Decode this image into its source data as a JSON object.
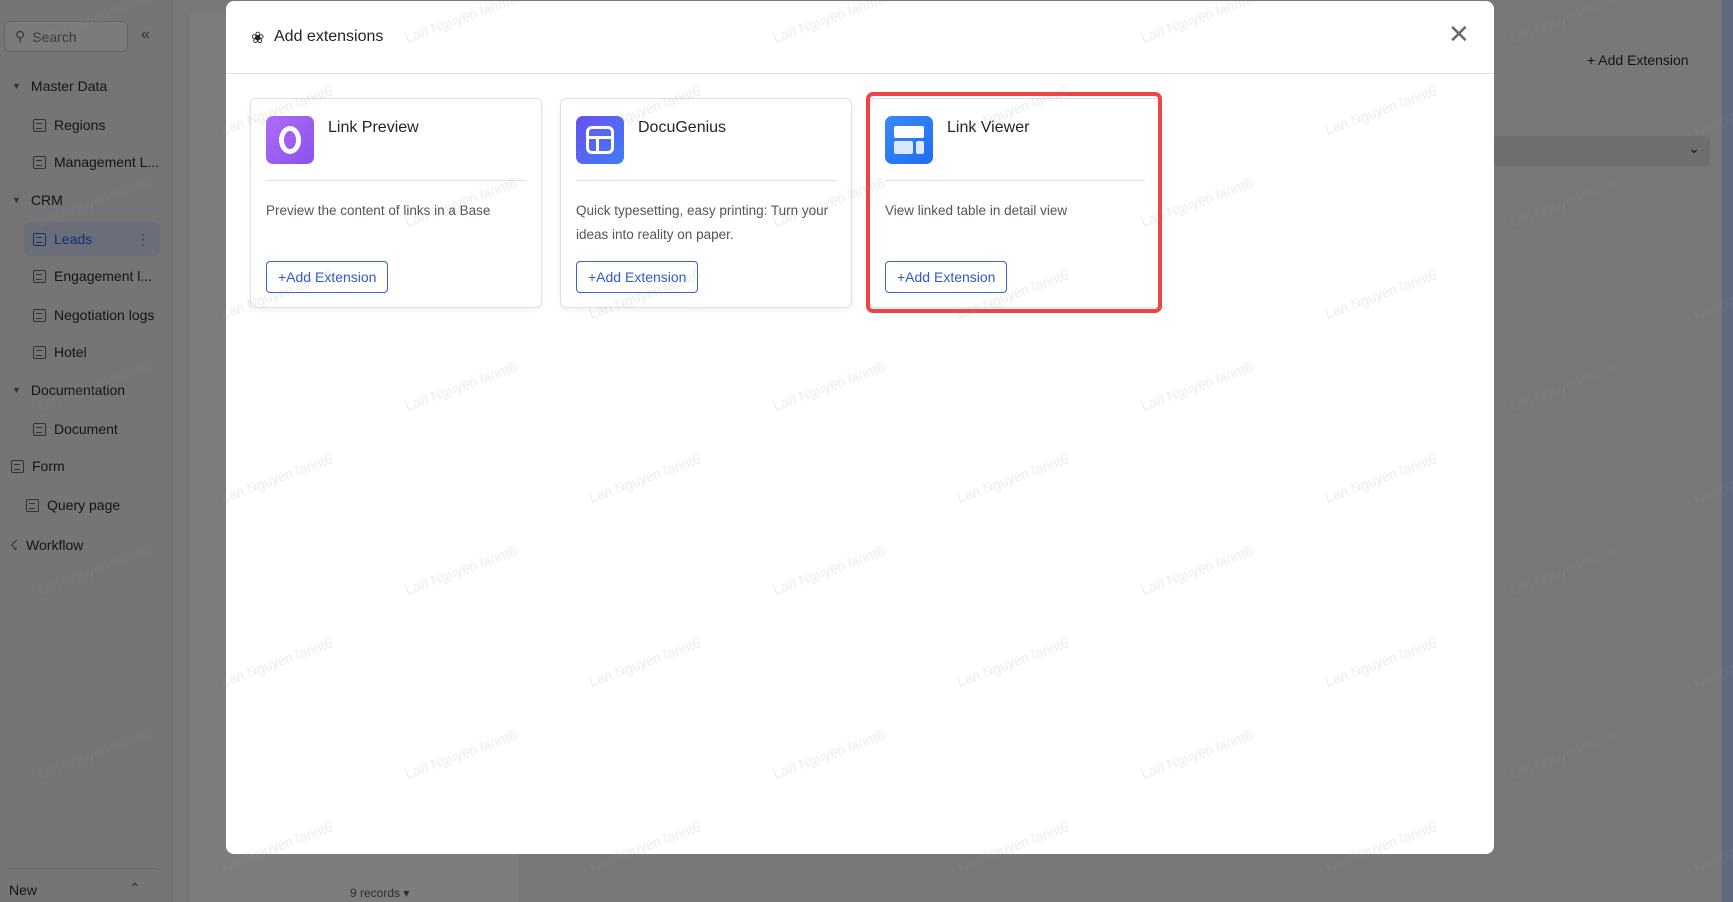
{
  "sidebar": {
    "search_placeholder": "Search",
    "collapse_icon": "double-chevron-left-icon",
    "items": [
      {
        "label": "Master Data",
        "type": "group"
      },
      {
        "label": "Regions",
        "type": "table"
      },
      {
        "label": "Management L...",
        "type": "table"
      },
      {
        "label": "CRM",
        "type": "group"
      },
      {
        "label": "Leads",
        "type": "table",
        "active": true
      },
      {
        "label": "Engagement l...",
        "type": "table"
      },
      {
        "label": "Negotiation logs",
        "type": "table"
      },
      {
        "label": "Hotel",
        "type": "table"
      },
      {
        "label": "Documentation",
        "type": "group"
      },
      {
        "label": "Document",
        "type": "document"
      },
      {
        "label": "Form",
        "type": "form"
      },
      {
        "label": "Query page",
        "type": "query"
      },
      {
        "label": "Workflow",
        "type": "workflow"
      }
    ],
    "new_label": "New"
  },
  "main": {
    "records": "9 records"
  },
  "right_panel": {
    "add_extension": "+ Add Extension"
  },
  "modal": {
    "title": "Add extensions",
    "close_icon": "close-icon",
    "cards": [
      {
        "title": "Link Preview",
        "description": "Preview the content of links in a Base",
        "button": "+Add Extension",
        "icon_color": "#9a5cf0"
      },
      {
        "title": "DocuGenius",
        "description": "Quick typesetting, easy printing: Turn your ideas into reality on paper.",
        "button": "+Add Extension",
        "icon_color": "#5b5ff0"
      },
      {
        "title": "Link Viewer",
        "description": "View linked table in detail view",
        "button": "+Add Extension",
        "icon_color": "#2f80f7",
        "highlighted": true
      }
    ]
  },
  "colors": {
    "highlight": "#ef4444",
    "accent": "#1456f0"
  },
  "watermark": "Lan Nguyen lannt6"
}
